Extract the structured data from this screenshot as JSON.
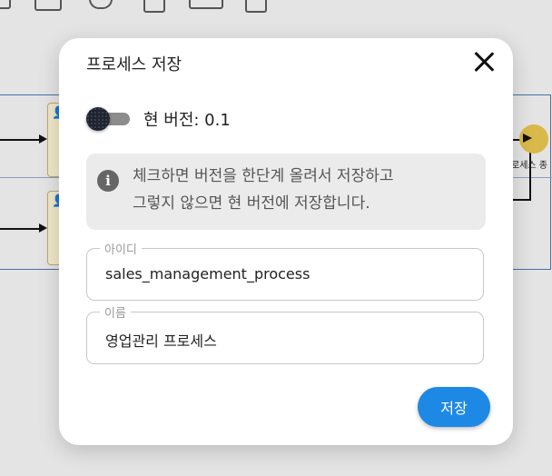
{
  "background": {
    "end_event_label": "로세스 종"
  },
  "modal": {
    "title": "프로세스 저장",
    "version_toggle": {
      "on": false,
      "label": "현 버전: 0.1"
    },
    "info": {
      "icon": "info-icon",
      "text_line1": "체크하면 버전을 한단계 올려서 저장하고",
      "text_line2": "그렇지 않으면 현 버전에 저장합니다."
    },
    "id_field": {
      "label": "아이디",
      "value": "sales_management_process"
    },
    "name_field": {
      "label": "이름",
      "value": "영업관리 프로세스"
    },
    "save_label": "저장"
  },
  "colors": {
    "accent": "#1e88e5",
    "end_event": "#d9b94a"
  }
}
